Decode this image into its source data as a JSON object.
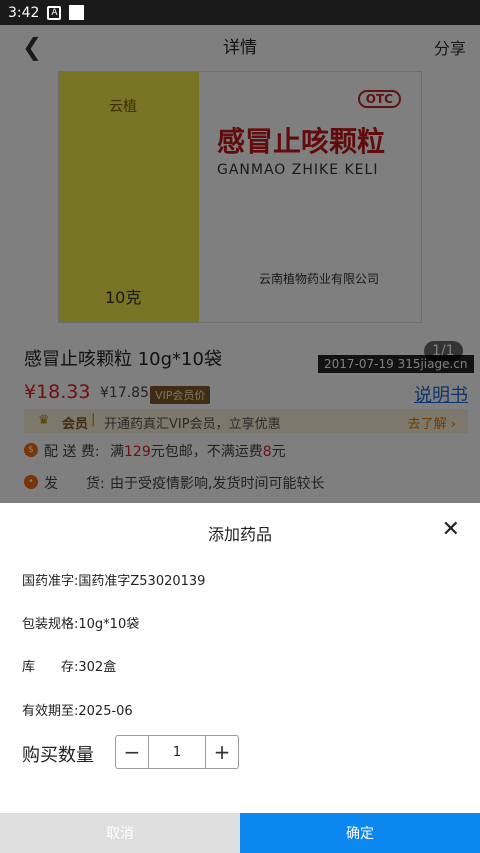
{
  "status_bar": {
    "time": "3:42",
    "notif_icon": "A"
  },
  "header": {
    "back_icon": "chevron-left-icon",
    "title": "详情",
    "share": "分享"
  },
  "image": {
    "brand": "云植",
    "otc": "OTC",
    "product_cn": "感冒止咳颗粒",
    "product_en": "GANMAO ZHIKE KELI",
    "weight": "10克",
    "maker": "云南植物药业有限公司",
    "watermark": "2017-07-19 315jiage.cn",
    "page_indicator": "1/1"
  },
  "product": {
    "name": "感冒止咳颗粒 10g*10袋",
    "price": "¥18.33",
    "vip_price": "¥17.85",
    "vip_badge": "VIP会员价",
    "manual_link": "说明书"
  },
  "member": {
    "label": "会员",
    "separator": "|",
    "text": "开通药真汇VIP会员，立享优惠",
    "link": "去了解 ›"
  },
  "shipping": {
    "label": "配 送 费:",
    "value_prefix": "满",
    "free_amount": "129",
    "value_mid": "元包邮，不满运费",
    "fee": "8",
    "value_suffix": "元"
  },
  "delivery": {
    "label": "发　　货:",
    "value": "由于受疫情影响,发货时间可能较长"
  },
  "sheet": {
    "title": "添加药品",
    "approval": "国药准字:国药准字Z53020139",
    "spec": "包装规格:10g*10袋",
    "stock_label": "库　　存:",
    "stock_value": "302盒",
    "expiry": "有效期至:2025-06",
    "qty_label": "购买数量",
    "qty_value": "1",
    "cancel": "取消",
    "confirm": "确定"
  },
  "colors": {
    "accent": "#0a88f0",
    "price": "#e02020",
    "link": "#1a6bd6"
  }
}
